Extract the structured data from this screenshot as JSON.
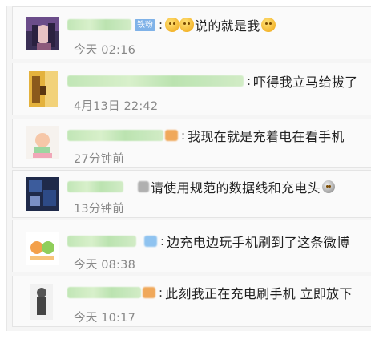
{
  "comments": [
    {
      "badge": "铁粉",
      "text": "说的就是我",
      "time": "今天 02:16",
      "emoji_before": [
        "cat-face-icon",
        "cat-face-icon"
      ],
      "emoji_after": "laughing-face-icon"
    },
    {
      "text": "吓得我立马给拔了",
      "time": "4月13日 22:42"
    },
    {
      "text": "我现在就是充着电在看手机",
      "time": "27分钟前",
      "emoji_before": [
        "tag-icon"
      ]
    },
    {
      "text": "请使用规范的数据线和充电头",
      "time": "13分钟前",
      "emoji_after": "lock-face-icon"
    },
    {
      "text": "边充电边玩手机刷到了这条微博",
      "time": "今天 08:38",
      "emoji_before": [
        "heart-icon"
      ]
    },
    {
      "text": "此刻我正在充电刷手机 立即放下",
      "time": "今天 10:17",
      "emoji_before": [
        "tag-icon"
      ]
    }
  ],
  "colors": {
    "badge": "#7fb2e8",
    "username_blur": "#c4e7b8",
    "time_text": "#888888",
    "comment_text": "#222222"
  }
}
